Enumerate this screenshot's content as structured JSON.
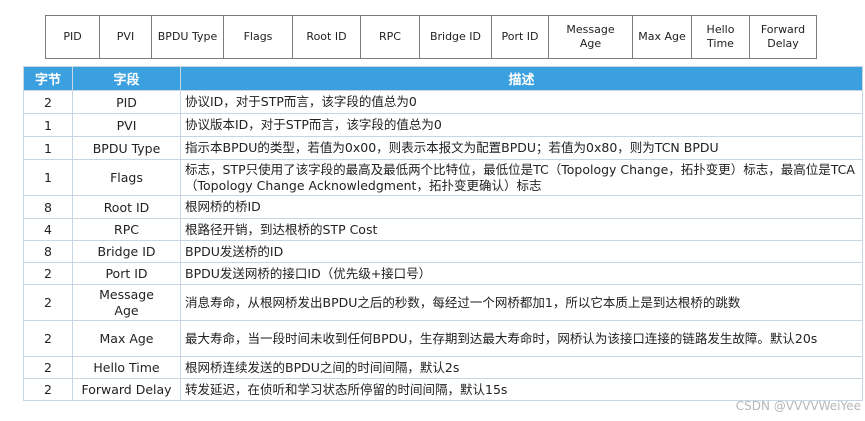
{
  "field_strip": [
    "PID",
    "PVI",
    "BPDU Type",
    "Flags",
    "Root ID",
    "RPC",
    "Bridge ID",
    "Port ID",
    "Message\nAge",
    "Max Age",
    "Hello\nTime",
    "Forward\nDelay"
  ],
  "table": {
    "headers": [
      "字节",
      "字段",
      "描述"
    ],
    "rows": [
      {
        "bytes": "2",
        "field": "PID",
        "desc": "协议ID，对于STP而言，该字段的值总为0"
      },
      {
        "bytes": "1",
        "field": "PVI",
        "desc": "协议版本ID，对于STP而言，该字段的值总为0"
      },
      {
        "bytes": "1",
        "field": "BPDU Type",
        "desc": "指示本BPDU的类型，若值为0x00，则表示本报文为配置BPDU；若值为0x80，则为TCN BPDU"
      },
      {
        "bytes": "1",
        "field": "Flags",
        "desc": "标志，STP只使用了该字段的最高及最低两个比特位，最低位是TC（Topology Change，拓扑变更）标志，最高位是TCA（Topology Change Acknowledgment，拓扑变更确认）标志"
      },
      {
        "bytes": "8",
        "field": "Root ID",
        "desc": "根网桥的桥ID"
      },
      {
        "bytes": "4",
        "field": "RPC",
        "desc": "根路径开销，到达根桥的STP Cost"
      },
      {
        "bytes": "8",
        "field": "Bridge ID",
        "desc": "BPDU发送桥的ID"
      },
      {
        "bytes": "2",
        "field": "Port ID",
        "desc": "BPDU发送网桥的接口ID（优先级+接口号）"
      },
      {
        "bytes": "2",
        "field": "Message\nAge",
        "desc": "消息寿命，从根网桥发出BPDU之后的秒数，每经过一个网桥都加1，所以它本质上是到达根桥的跳数"
      },
      {
        "bytes": "2",
        "field": "Max Age",
        "desc": "最大寿命，当一段时间未收到任何BPDU，生存期到达最大寿命时，网桥认为该接口连接的链路发生故障。默认20s"
      },
      {
        "bytes": "2",
        "field": "Hello Time",
        "desc": "根网桥连续发送的BPDU之间的时间间隔，默认2s"
      },
      {
        "bytes": "2",
        "field": "Forward Delay",
        "desc": "转发延迟，在侦听和学习状态所停留的时间间隔，默认15s"
      }
    ]
  },
  "watermark": "CSDN @VVVVWeiYee"
}
